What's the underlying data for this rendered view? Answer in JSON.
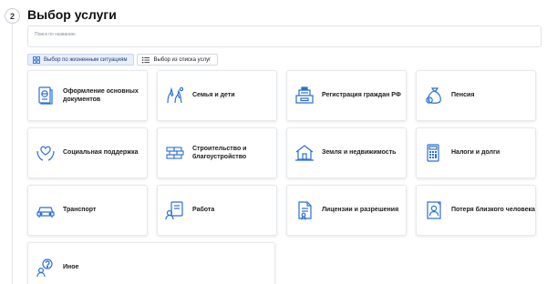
{
  "step": {
    "number": "2",
    "title": "Выбор услуги"
  },
  "search": {
    "placeholder": "Поиск по названию"
  },
  "tabs": [
    {
      "label": "Выбор по жизненным ситуациям",
      "icon": "grid-icon",
      "active": true
    },
    {
      "label": "Выбор из списка услуг",
      "icon": "list-icon",
      "active": false
    }
  ],
  "categories": [
    {
      "label": "Оформление основных документов",
      "icon": "passport-icon"
    },
    {
      "label": "Семья и дети",
      "icon": "family-hands-icon"
    },
    {
      "label": "Регистрация граждан РФ",
      "icon": "registration-icon"
    },
    {
      "label": "Пенсия",
      "icon": "money-bag-icon"
    },
    {
      "label": "Социальная поддержка",
      "icon": "heart-hands-icon"
    },
    {
      "label": "Строительство и благоустройство",
      "icon": "bricks-icon"
    },
    {
      "label": "Земля и недвижимость",
      "icon": "house-icon"
    },
    {
      "label": "Налоги и долги",
      "icon": "calculator-icon"
    },
    {
      "label": "Транспорт",
      "icon": "car-icon"
    },
    {
      "label": "Работа",
      "icon": "job-icon"
    },
    {
      "label": "Лицензии и разрешения",
      "icon": "license-icon"
    },
    {
      "label": "Потеря близкого человека",
      "icon": "portrait-frame-icon"
    },
    {
      "label": "Иное",
      "icon": "question-person-icon"
    }
  ],
  "colors": {
    "icon_blue": "#2b6fd6",
    "active_tab_bg": "#e8effa"
  }
}
